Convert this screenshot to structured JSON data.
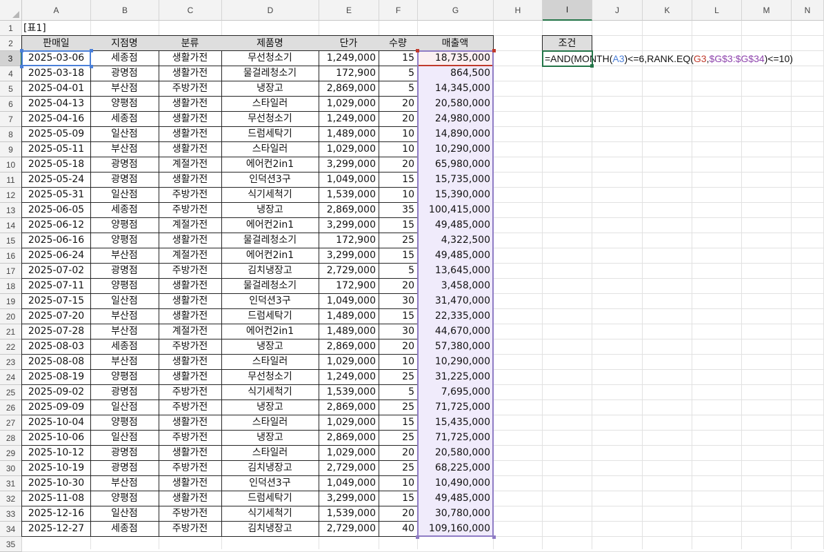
{
  "columns": [
    "A",
    "B",
    "C",
    "D",
    "E",
    "F",
    "G",
    "H",
    "I",
    "J",
    "K",
    "L",
    "M",
    "N"
  ],
  "rows": [
    "1",
    "2",
    "3",
    "4",
    "5",
    "6",
    "7",
    "8",
    "9",
    "10",
    "11",
    "12",
    "13",
    "14",
    "15",
    "16",
    "17",
    "18",
    "19",
    "20",
    "21",
    "22",
    "23",
    "24",
    "25",
    "26",
    "27",
    "28",
    "29",
    "30",
    "31",
    "32",
    "33",
    "34",
    "35"
  ],
  "selected_column": "I",
  "selected_row": "3",
  "table_title": "[표1]",
  "headers": [
    "판매일",
    "지점명",
    "분류",
    "제품명",
    "단가",
    "수량",
    "매출액"
  ],
  "condition_header": "조건",
  "formula": {
    "p1": "=AND(MONTH(",
    "p2": "A3",
    "p3": ")<=6,RANK.EQ(",
    "p4": "G3",
    "p5": ",",
    "p6": "$G$3:$G$34",
    "p7": ")<=10)"
  },
  "data": [
    [
      "2025-03-06",
      "세종점",
      "생활가전",
      "무선청소기",
      "1,249,000",
      "15",
      "18,735,000"
    ],
    [
      "2025-03-18",
      "광명점",
      "생활가전",
      "물걸레청소기",
      "172,900",
      "5",
      "864,500"
    ],
    [
      "2025-04-01",
      "부산점",
      "주방가전",
      "냉장고",
      "2,869,000",
      "5",
      "14,345,000"
    ],
    [
      "2025-04-13",
      "양평점",
      "생활가전",
      "스타일러",
      "1,029,000",
      "20",
      "20,580,000"
    ],
    [
      "2025-04-16",
      "세종점",
      "생활가전",
      "무선청소기",
      "1,249,000",
      "20",
      "24,980,000"
    ],
    [
      "2025-05-09",
      "일산점",
      "생활가전",
      "드럼세탁기",
      "1,489,000",
      "10",
      "14,890,000"
    ],
    [
      "2025-05-11",
      "부산점",
      "생활가전",
      "스타일러",
      "1,029,000",
      "10",
      "10,290,000"
    ],
    [
      "2025-05-18",
      "광명점",
      "계절가전",
      "에어컨2in1",
      "3,299,000",
      "20",
      "65,980,000"
    ],
    [
      "2025-05-24",
      "광명점",
      "생활가전",
      "인덕션3구",
      "1,049,000",
      "15",
      "15,735,000"
    ],
    [
      "2025-05-31",
      "일산점",
      "주방가전",
      "식기세척기",
      "1,539,000",
      "10",
      "15,390,000"
    ],
    [
      "2025-06-05",
      "세종점",
      "주방가전",
      "냉장고",
      "2,869,000",
      "35",
      "100,415,000"
    ],
    [
      "2025-06-12",
      "양평점",
      "계절가전",
      "에어컨2in1",
      "3,299,000",
      "15",
      "49,485,000"
    ],
    [
      "2025-06-16",
      "양평점",
      "생활가전",
      "물걸레청소기",
      "172,900",
      "25",
      "4,322,500"
    ],
    [
      "2025-06-24",
      "부산점",
      "계절가전",
      "에어컨2in1",
      "3,299,000",
      "15",
      "49,485,000"
    ],
    [
      "2025-07-02",
      "광명점",
      "주방가전",
      "김치냉장고",
      "2,729,000",
      "5",
      "13,645,000"
    ],
    [
      "2025-07-11",
      "양평점",
      "생활가전",
      "물걸레청소기",
      "172,900",
      "20",
      "3,458,000"
    ],
    [
      "2025-07-15",
      "일산점",
      "생활가전",
      "인덕션3구",
      "1,049,000",
      "30",
      "31,470,000"
    ],
    [
      "2025-07-20",
      "부산점",
      "생활가전",
      "드럼세탁기",
      "1,489,000",
      "15",
      "22,335,000"
    ],
    [
      "2025-07-28",
      "부산점",
      "계절가전",
      "에어컨2in1",
      "1,489,000",
      "30",
      "44,670,000"
    ],
    [
      "2025-08-03",
      "세종점",
      "주방가전",
      "냉장고",
      "2,869,000",
      "20",
      "57,380,000"
    ],
    [
      "2025-08-08",
      "부산점",
      "생활가전",
      "스타일러",
      "1,029,000",
      "10",
      "10,290,000"
    ],
    [
      "2025-08-19",
      "양평점",
      "생활가전",
      "무선청소기",
      "1,249,000",
      "25",
      "31,225,000"
    ],
    [
      "2025-09-02",
      "광명점",
      "주방가전",
      "식기세척기",
      "1,539,000",
      "5",
      "7,695,000"
    ],
    [
      "2025-09-09",
      "일산점",
      "주방가전",
      "냉장고",
      "2,869,000",
      "25",
      "71,725,000"
    ],
    [
      "2025-10-04",
      "양평점",
      "생활가전",
      "스타일러",
      "1,029,000",
      "15",
      "15,435,000"
    ],
    [
      "2025-10-06",
      "일산점",
      "주방가전",
      "냉장고",
      "2,869,000",
      "25",
      "71,725,000"
    ],
    [
      "2025-10-12",
      "광명점",
      "생활가전",
      "스타일러",
      "1,029,000",
      "20",
      "20,580,000"
    ],
    [
      "2025-10-19",
      "광명점",
      "주방가전",
      "김치냉장고",
      "2,729,000",
      "25",
      "68,225,000"
    ],
    [
      "2025-10-30",
      "부산점",
      "생활가전",
      "인덕션3구",
      "1,049,000",
      "10",
      "10,490,000"
    ],
    [
      "2025-11-08",
      "양평점",
      "생활가전",
      "드럼세탁기",
      "3,299,000",
      "15",
      "49,485,000"
    ],
    [
      "2025-12-16",
      "일산점",
      "주방가전",
      "식기세척기",
      "1,539,000",
      "20",
      "30,780,000"
    ],
    [
      "2025-12-27",
      "세종점",
      "주방가전",
      "김치냉장고",
      "2,729,000",
      "40",
      "109,160,000"
    ]
  ]
}
